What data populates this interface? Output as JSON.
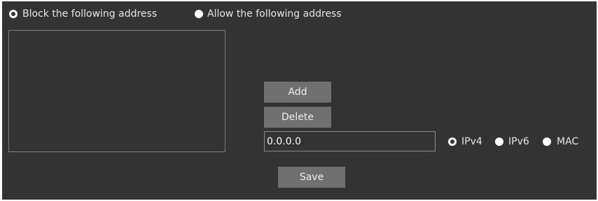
{
  "mode": {
    "block_label": "Block the following address",
    "allow_label": "Allow the following address",
    "selected": "block"
  },
  "address_list": {
    "items": []
  },
  "buttons": {
    "add_label": "Add",
    "delete_label": "Delete",
    "save_label": "Save"
  },
  "address_input": {
    "value": "0.0.0.0"
  },
  "address_type": {
    "ipv4_label": "IPv4",
    "ipv6_label": "IPv6",
    "mac_label": "MAC",
    "selected": "IPv4"
  },
  "colors": {
    "panel_background": "#333333",
    "button_background": "#707070",
    "text": "#e6e6e6"
  }
}
